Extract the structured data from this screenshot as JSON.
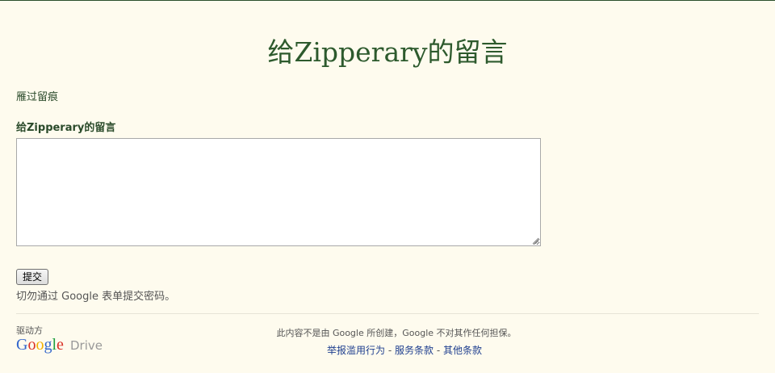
{
  "form": {
    "title": "给Zipperary的留言",
    "description": "雁过留痕",
    "question_label": "给Zipperary的留言",
    "answer_value": "",
    "submit_label": "提交",
    "password_warning": "切勿通过 Google 表单提交密码。"
  },
  "footer": {
    "powered_by": "驱动方",
    "logo_letters": [
      "G",
      "o",
      "o",
      "g",
      "l",
      "e"
    ],
    "drive_label": "Drive",
    "disclaimer": "此内容不是由 Google 所创建，Google 不对其作任何担保。",
    "links": [
      {
        "label": "举报滥用行为"
      },
      {
        "label": "服务条款"
      },
      {
        "label": "其他条款"
      }
    ],
    "separator": "-"
  },
  "colors": {
    "background": "#fefbee",
    "title": "#2d5a2d",
    "link": "#1f3f8f",
    "logo_blue": "#3366cc",
    "logo_red": "#d93025",
    "logo_yellow": "#f2b100",
    "logo_green": "#1e9e3e"
  }
}
